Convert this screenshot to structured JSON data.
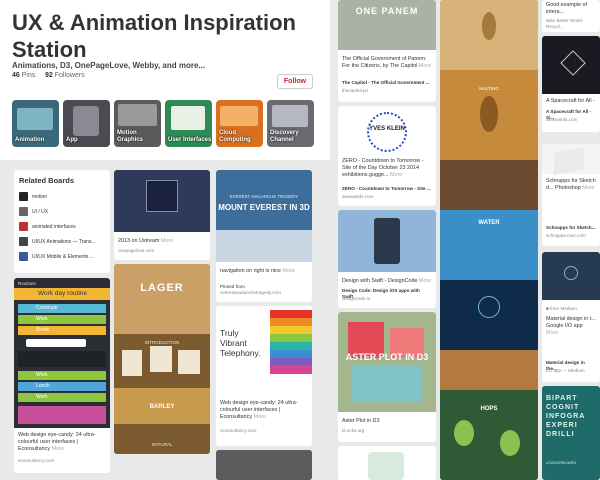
{
  "board": {
    "title": "UX & Animation Inspiration Station",
    "description": "Animations, D3, OnePageLove, Webby, and more...",
    "pins_count": "46",
    "pins_label": "Pins",
    "followers_count": "92",
    "followers_label": "Followers",
    "follow_label": "Follow"
  },
  "sections": [
    {
      "label": "Animation",
      "color": "#3a6a7a"
    },
    {
      "label": "App",
      "color": "#4a4a52"
    },
    {
      "label": "Motion Graphics",
      "color": "#5a5a5a"
    },
    {
      "label": "User Interfaces",
      "color": "#2e8a52"
    },
    {
      "label": "Cloud Computing",
      "color": "#d9701f"
    },
    {
      "label": "Discovery Channel",
      "color": "#6a6a70"
    }
  ],
  "related_boards": {
    "title": "Related Boards",
    "items": [
      {
        "label": "motion",
        "color": "#222"
      },
      {
        "label": "UI / UX",
        "color": "#666"
      },
      {
        "label": "animated interfaces",
        "color": "#b33"
      },
      {
        "label": "UI/UX Animations — Trans...",
        "color": "#444"
      },
      {
        "label": "UI/UX Mobile & Elements ...",
        "color": "#3b5998"
      }
    ]
  },
  "routine": {
    "app_label": "Routines",
    "title": "Work day routine",
    "rows": [
      {
        "label": "Commute",
        "color": "#58b9d6"
      },
      {
        "label": "Work",
        "color": "#8ec63f"
      },
      {
        "label": "Break",
        "color": "#f2b632"
      },
      {
        "label": "Work",
        "color": "#8ec63f"
      },
      {
        "label": "Lunch",
        "color": "#4fa7d9"
      },
      {
        "label": "Work",
        "color": "#8ec63f"
      }
    ],
    "caption": "Web design eye-candy: 24 ultra-colourful user interfaces | Econsultancy",
    "more": "More",
    "source": "econsultancy.com"
  },
  "pins": {
    "ustream_caption": "2013 on Ustream",
    "ustream_more": "More",
    "ustream_source": "onepagelove.com",
    "lager_header": "LAGER",
    "lager_intro": "INTRODUCTION",
    "barley_header": "BARLEY",
    "natural_header": "NATURAL",
    "everest_small": "EVEREST AVALANCHE TRAGEDY",
    "everest_title": "MOUNT EVEREST IN 3D",
    "nav_caption": "navigation on right is nice",
    "nav_more": "More",
    "pinned_from": "Pinned from",
    "nav_source": "everestavalanchetragedy.com",
    "telephony_line1": "Truly",
    "telephony_line2": "Vibrant",
    "telephony_line3": "Telephony.",
    "telephony_caption": "Web design eye-candy: 24 ultra-colourful user interfaces | Econsultancy",
    "telephony_more": "More",
    "telephony_source": "econsultancy.com",
    "panem_title": "ONE PANEM",
    "panem_caption": "The Official Government of Panem: For the Citizens, by The Capitol",
    "panem_more": "More",
    "panem_sub": "The Capitol - The Official Government ...",
    "panem_source": "thecapitol.pn",
    "klein_title": "YVES KLEIN",
    "klein_caption": "ZERO - Countdown to Tomorrow - Site of the Day October 23 2014 exhibitions.gugge...",
    "klein_more": "More",
    "klein_sub": "ZERO - Countdown to Tomorrow - Site ...",
    "klein_source": "awwwards.com",
    "swift_caption": "Design with Swift - DesignCode",
    "swift_more": "More",
    "swift_sub": "Design Code: Design iOS apps with Swift",
    "swift_source": "designcode.io",
    "aster_title": "ASTER PLOT IN D3",
    "aster_caption": "Aster Plot in D3",
    "aster_source": "bl.ocks.org",
    "malting_label": "MALTING",
    "water_label": "WATER",
    "hops_label": "HOPS",
    "good_caption": "Good example of intera...",
    "nike_caption": "Nike Better World Recycl...",
    "spacecraft_caption": "A Spacecraft for All -",
    "spacecraft_sub": "A Spacecraft for All - Si...",
    "spacecraft_source": "awwwards.com",
    "schnapps_caption": "Schnapps for Sketch d... Photoshop",
    "schnapps_more": "More",
    "schnapps_sub": "Schnapps for Sketch...",
    "schnapps_source": "schnapps-mac.com",
    "medium_label": "from Medium",
    "material_caption": "Material design in t... Google I/O app",
    "material_more": "More",
    "material_sub": "Material design in the...",
    "material_source": "I/O app — Medium",
    "bipart_title": "BIPART COGNIT INFOGRA EXPERI DRILLI",
    "leaderboard": "LEADERBOARD"
  }
}
